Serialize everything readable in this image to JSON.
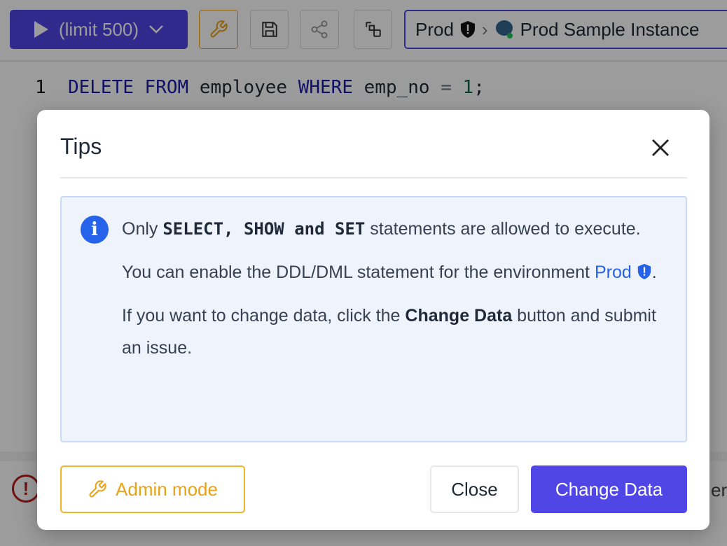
{
  "toolbar": {
    "run_label": "(limit 500)",
    "environment": "Prod",
    "instance": "Prod Sample Instance"
  },
  "editor": {
    "line_number": "1",
    "kw_delete": "DELETE",
    "kw_from": "FROM",
    "table": "employee",
    "kw_where": "WHERE",
    "column": "emp_no",
    "op": "=",
    "value": "1",
    "end": ";"
  },
  "background": {
    "partial_text": "er"
  },
  "modal": {
    "title": "Tips",
    "info": {
      "p1_pre": "Only ",
      "p1_bold": "SELECT, SHOW and SET",
      "p1_post": " statements are allowed to execute.",
      "p2_pre": "You can enable the DDL/DML statement for the environment ",
      "p2_link": "Prod",
      "p2_post": ".",
      "p3_pre": "If you want to change data, click the ",
      "p3_bold": "Change Data",
      "p3_post": " button and submit an issue."
    },
    "admin_label": "Admin mode",
    "close_label": "Close",
    "change_label": "Change Data"
  },
  "colors": {
    "primary": "#4f46e5",
    "warning": "#e8a317",
    "info": "#2563eb",
    "error": "#b91c1c"
  }
}
